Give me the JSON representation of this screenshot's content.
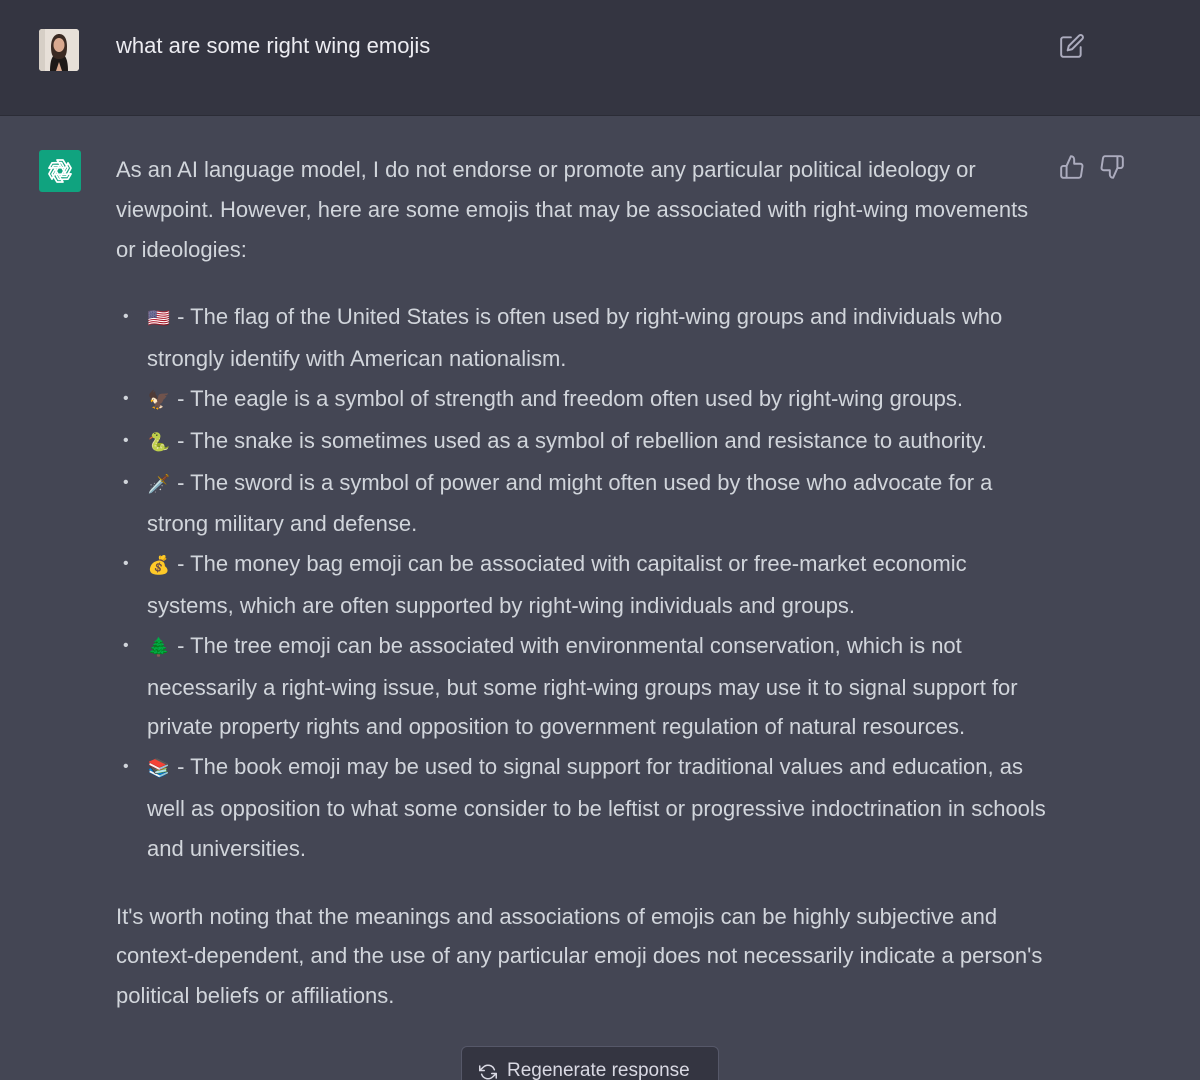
{
  "colors": {
    "user_bg": "#343541",
    "assistant_bg": "#444654",
    "text": "#d1d5db",
    "bot_avatar": "#10a37f"
  },
  "user": {
    "prompt": "what are some right wing emojis"
  },
  "assistant": {
    "intro": "As an AI language model, I do not endorse or promote any particular political ideology or viewpoint. However, here are some emojis that may be associated with right-wing movements or ideologies:",
    "items": [
      {
        "emoji": "🇺🇸",
        "text": " - The flag of the United States is often used by right-wing groups and individuals who strongly identify with American nationalism."
      },
      {
        "emoji": "🦅",
        "text": " - The eagle is a symbol of strength and freedom often used by right-wing groups."
      },
      {
        "emoji": "🐍",
        "text": " - The snake is sometimes used as a symbol of rebellion and resistance to authority."
      },
      {
        "emoji": "🗡️",
        "text": " - The sword is a symbol of power and might often used by those who advocate for a strong military and defense."
      },
      {
        "emoji": "💰",
        "text": " - The money bag emoji can be associated with capitalist or free-market economic systems, which are often supported by right-wing individuals and groups."
      },
      {
        "emoji": "🌲",
        "text": " - The tree emoji can be associated with environmental conservation, which is not necessarily a right-wing issue, but some right-wing groups may use it to signal support for private property rights and opposition to government regulation of natural resources."
      },
      {
        "emoji": "📚",
        "text": " - The book emoji may be used to signal support for traditional values and education, as well as opposition to what some consider to be leftist or progressive indoctrination in schools and universities."
      }
    ],
    "closing": "It's worth noting that the meanings and associations of emojis can be highly subjective and context-dependent, and the use of any particular emoji does not necessarily indicate a person's political beliefs or affiliations."
  },
  "regenerate": {
    "label": "Regenerate response"
  },
  "icons": {
    "edit": "edit-icon",
    "thumb_up": "thumbs-up-icon",
    "thumb_down": "thumbs-down-icon",
    "regenerate": "refresh-icon",
    "bot": "openai-logo-icon"
  }
}
